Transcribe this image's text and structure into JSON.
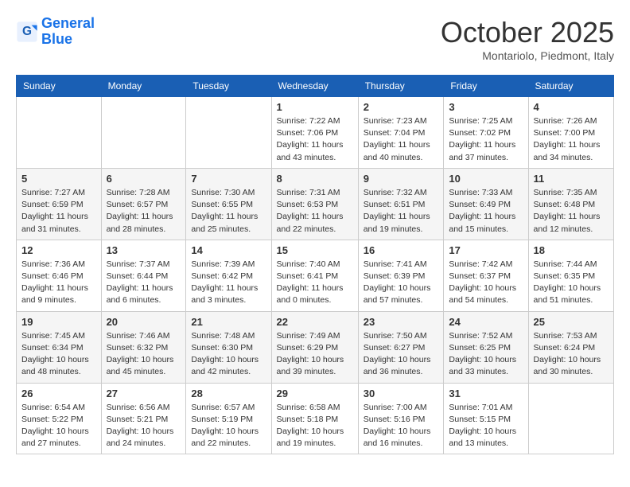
{
  "header": {
    "logo_line1": "General",
    "logo_line2": "Blue",
    "month": "October 2025",
    "location": "Montariolo, Piedmont, Italy"
  },
  "days_of_week": [
    "Sunday",
    "Monday",
    "Tuesday",
    "Wednesday",
    "Thursday",
    "Friday",
    "Saturday"
  ],
  "weeks": [
    [
      {
        "day": "",
        "info": ""
      },
      {
        "day": "",
        "info": ""
      },
      {
        "day": "",
        "info": ""
      },
      {
        "day": "1",
        "info": "Sunrise: 7:22 AM\nSunset: 7:06 PM\nDaylight: 11 hours and 43 minutes."
      },
      {
        "day": "2",
        "info": "Sunrise: 7:23 AM\nSunset: 7:04 PM\nDaylight: 11 hours and 40 minutes."
      },
      {
        "day": "3",
        "info": "Sunrise: 7:25 AM\nSunset: 7:02 PM\nDaylight: 11 hours and 37 minutes."
      },
      {
        "day": "4",
        "info": "Sunrise: 7:26 AM\nSunset: 7:00 PM\nDaylight: 11 hours and 34 minutes."
      }
    ],
    [
      {
        "day": "5",
        "info": "Sunrise: 7:27 AM\nSunset: 6:59 PM\nDaylight: 11 hours and 31 minutes."
      },
      {
        "day": "6",
        "info": "Sunrise: 7:28 AM\nSunset: 6:57 PM\nDaylight: 11 hours and 28 minutes."
      },
      {
        "day": "7",
        "info": "Sunrise: 7:30 AM\nSunset: 6:55 PM\nDaylight: 11 hours and 25 minutes."
      },
      {
        "day": "8",
        "info": "Sunrise: 7:31 AM\nSunset: 6:53 PM\nDaylight: 11 hours and 22 minutes."
      },
      {
        "day": "9",
        "info": "Sunrise: 7:32 AM\nSunset: 6:51 PM\nDaylight: 11 hours and 19 minutes."
      },
      {
        "day": "10",
        "info": "Sunrise: 7:33 AM\nSunset: 6:49 PM\nDaylight: 11 hours and 15 minutes."
      },
      {
        "day": "11",
        "info": "Sunrise: 7:35 AM\nSunset: 6:48 PM\nDaylight: 11 hours and 12 minutes."
      }
    ],
    [
      {
        "day": "12",
        "info": "Sunrise: 7:36 AM\nSunset: 6:46 PM\nDaylight: 11 hours and 9 minutes."
      },
      {
        "day": "13",
        "info": "Sunrise: 7:37 AM\nSunset: 6:44 PM\nDaylight: 11 hours and 6 minutes."
      },
      {
        "day": "14",
        "info": "Sunrise: 7:39 AM\nSunset: 6:42 PM\nDaylight: 11 hours and 3 minutes."
      },
      {
        "day": "15",
        "info": "Sunrise: 7:40 AM\nSunset: 6:41 PM\nDaylight: 11 hours and 0 minutes."
      },
      {
        "day": "16",
        "info": "Sunrise: 7:41 AM\nSunset: 6:39 PM\nDaylight: 10 hours and 57 minutes."
      },
      {
        "day": "17",
        "info": "Sunrise: 7:42 AM\nSunset: 6:37 PM\nDaylight: 10 hours and 54 minutes."
      },
      {
        "day": "18",
        "info": "Sunrise: 7:44 AM\nSunset: 6:35 PM\nDaylight: 10 hours and 51 minutes."
      }
    ],
    [
      {
        "day": "19",
        "info": "Sunrise: 7:45 AM\nSunset: 6:34 PM\nDaylight: 10 hours and 48 minutes."
      },
      {
        "day": "20",
        "info": "Sunrise: 7:46 AM\nSunset: 6:32 PM\nDaylight: 10 hours and 45 minutes."
      },
      {
        "day": "21",
        "info": "Sunrise: 7:48 AM\nSunset: 6:30 PM\nDaylight: 10 hours and 42 minutes."
      },
      {
        "day": "22",
        "info": "Sunrise: 7:49 AM\nSunset: 6:29 PM\nDaylight: 10 hours and 39 minutes."
      },
      {
        "day": "23",
        "info": "Sunrise: 7:50 AM\nSunset: 6:27 PM\nDaylight: 10 hours and 36 minutes."
      },
      {
        "day": "24",
        "info": "Sunrise: 7:52 AM\nSunset: 6:25 PM\nDaylight: 10 hours and 33 minutes."
      },
      {
        "day": "25",
        "info": "Sunrise: 7:53 AM\nSunset: 6:24 PM\nDaylight: 10 hours and 30 minutes."
      }
    ],
    [
      {
        "day": "26",
        "info": "Sunrise: 6:54 AM\nSunset: 5:22 PM\nDaylight: 10 hours and 27 minutes."
      },
      {
        "day": "27",
        "info": "Sunrise: 6:56 AM\nSunset: 5:21 PM\nDaylight: 10 hours and 24 minutes."
      },
      {
        "day": "28",
        "info": "Sunrise: 6:57 AM\nSunset: 5:19 PM\nDaylight: 10 hours and 22 minutes."
      },
      {
        "day": "29",
        "info": "Sunrise: 6:58 AM\nSunset: 5:18 PM\nDaylight: 10 hours and 19 minutes."
      },
      {
        "day": "30",
        "info": "Sunrise: 7:00 AM\nSunset: 5:16 PM\nDaylight: 10 hours and 16 minutes."
      },
      {
        "day": "31",
        "info": "Sunrise: 7:01 AM\nSunset: 5:15 PM\nDaylight: 10 hours and 13 minutes."
      },
      {
        "day": "",
        "info": ""
      }
    ]
  ]
}
